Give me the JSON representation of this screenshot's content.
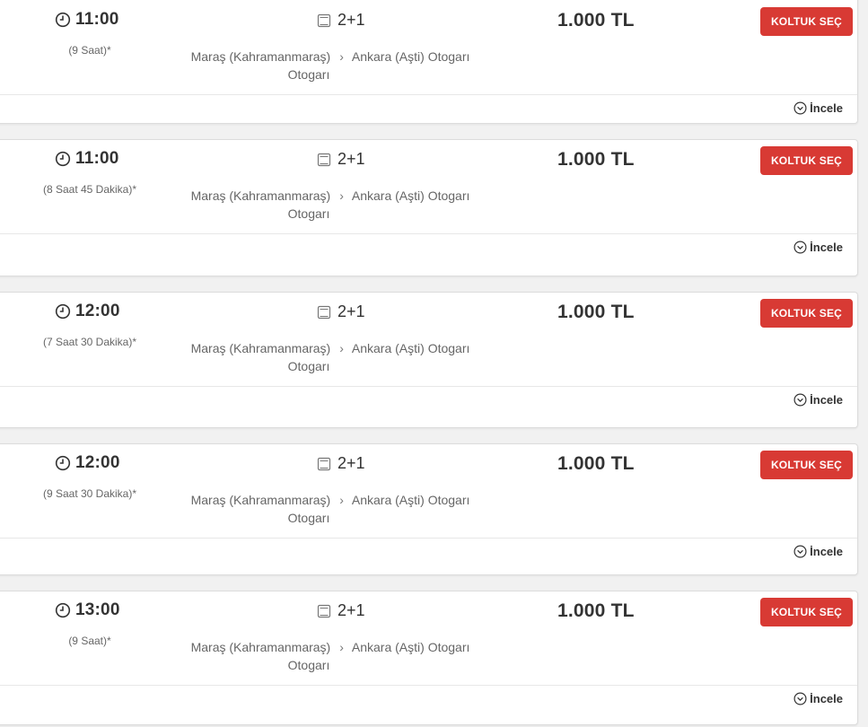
{
  "colors": {
    "accent": "#d83a34",
    "text": "#333333",
    "muted": "#666666"
  },
  "icons": {
    "time": "clock-icon",
    "seat": "seat-icon",
    "expand": "chevron-down-circle-icon"
  },
  "trips": [
    {
      "time": "11:00",
      "duration": "(9 Saat)*",
      "seat_layout": "2+1",
      "from": "Maraş (Kahramanmaraş)",
      "to": "Ankara (Aşti) Otogarı",
      "to_suffix": "Otogarı",
      "price": "1.000 TL",
      "select_label": "KOLTUK SEÇ",
      "details_label": "İncele"
    },
    {
      "time": "11:00",
      "duration": "(8 Saat 45 Dakika)*",
      "seat_layout": "2+1",
      "from": "Maraş (Kahramanmaraş)",
      "to": "Ankara (Aşti) Otogarı",
      "to_suffix": "Otogarı",
      "price": "1.000 TL",
      "select_label": "KOLTUK SEÇ",
      "details_label": "İncele"
    },
    {
      "time": "12:00",
      "duration": "(7 Saat 30 Dakika)*",
      "seat_layout": "2+1",
      "from": "Maraş (Kahramanmaraş)",
      "to": "Ankara (Aşti) Otogarı",
      "to_suffix": "Otogarı",
      "price": "1.000 TL",
      "select_label": "KOLTUK SEÇ",
      "details_label": "İncele"
    },
    {
      "time": "12:00",
      "duration": "(9 Saat 30 Dakika)*",
      "seat_layout": "2+1",
      "from": "Maraş (Kahramanmaraş)",
      "to": "Ankara (Aşti) Otogarı",
      "to_suffix": "Otogarı",
      "price": "1.000 TL",
      "select_label": "KOLTUK SEÇ",
      "details_label": "İncele"
    },
    {
      "time": "13:00",
      "duration": "(9 Saat)*",
      "seat_layout": "2+1",
      "from": "Maraş (Kahramanmaraş)",
      "to": "Ankara (Aşti) Otogarı",
      "to_suffix": "Otogarı",
      "price": "1.000 TL",
      "select_label": "KOLTUK SEÇ",
      "details_label": "İncele"
    }
  ]
}
